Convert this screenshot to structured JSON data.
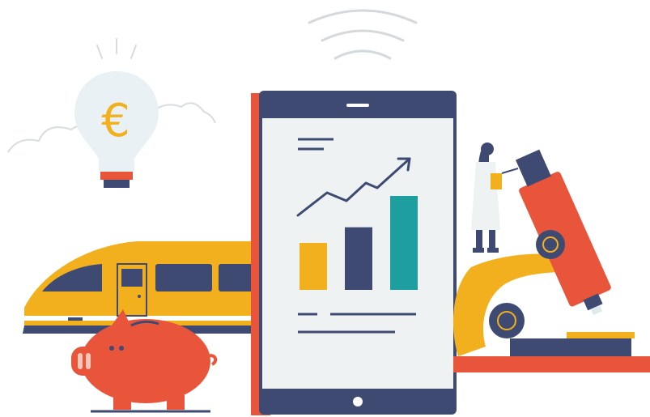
{
  "illustration": {
    "bulb": {
      "symbol": "€"
    },
    "colors": {
      "navy": "#3f4a73",
      "orange": "#e8553a",
      "yellow": "#f2b01e",
      "teal": "#1f9ea0",
      "paper": "#eef2f2",
      "light_blue": "#dfe9ec",
      "grey_line": "#cfd6d8"
    }
  },
  "chart_data": {
    "type": "bar",
    "categories": [
      "",
      "",
      ""
    ],
    "values": [
      3,
      4,
      6
    ],
    "colors": [
      "#f2b01e",
      "#3f4a73",
      "#1f9ea0"
    ],
    "trend_line": true,
    "title": "",
    "xlabel": "",
    "ylabel": ""
  }
}
